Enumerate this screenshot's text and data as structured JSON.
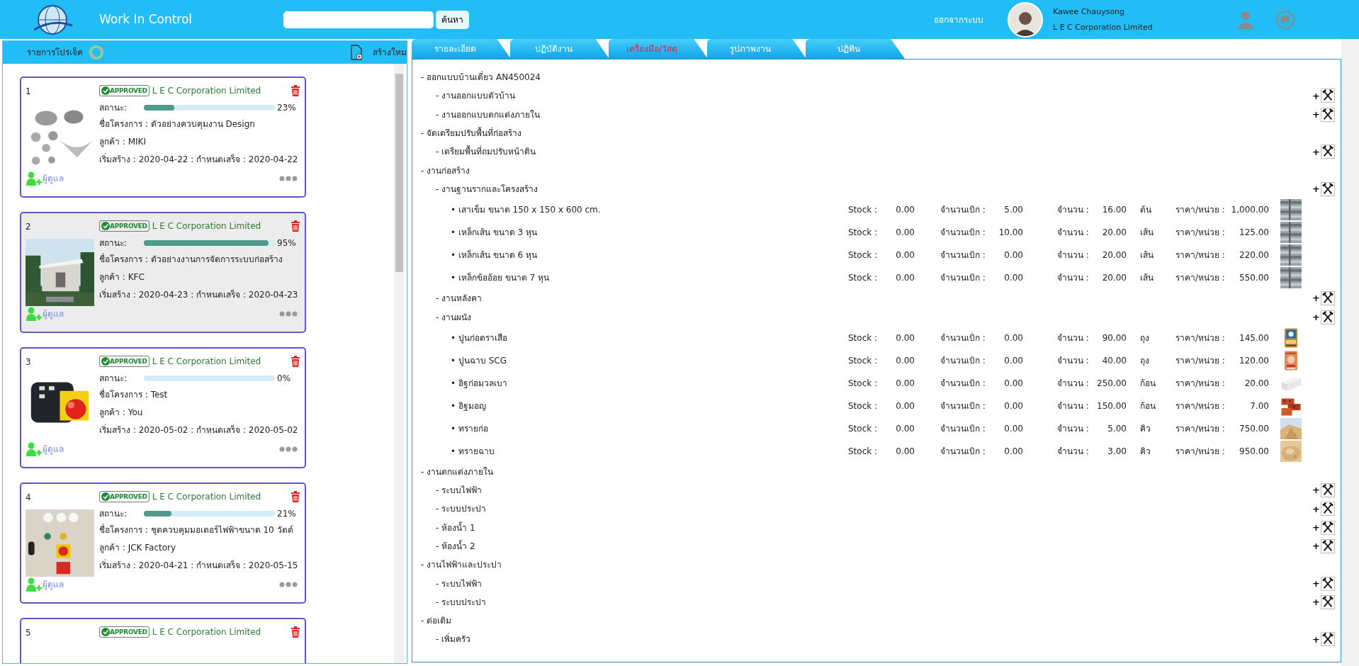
{
  "header": {
    "title": "Work In Control",
    "search": {
      "button": "ค้นหา"
    },
    "logout": "ออกจากระบบ",
    "user": {
      "name": "Kawee Chauysong",
      "company": "L E C Corporation Limited"
    }
  },
  "projects_panel": {
    "title": "รายการโปรเจ็ค",
    "create": "สร้างใหม",
    "projects": [
      {
        "number": "1",
        "badge": "APPROVED",
        "company": "L E C Corporation Limited",
        "selected": false,
        "status_label": "สถานะ:",
        "level": 0.23,
        "percent": "23%",
        "name": "ชื่อโครงการ : ตัวอย่างควบคุมงาน Design",
        "customer": "ลูกค้า : MIKI",
        "dates": "เริ่มสร้าง : 2020-04-22 : กำหนดเสร็จ : 2020-04-22",
        "manager": "ผู้ดูแล"
      },
      {
        "number": "2",
        "badge": "APPROVED",
        "company": "L E C Corporation Limited",
        "selected": true,
        "status_label": "สถานะ:",
        "level": 0.95,
        "percent": "95%",
        "name": "ชื่อโครงการ : ตัวอย่างงานการจัดการระบบก่อสร้าง",
        "customer": "ลูกค้า : KFC",
        "dates": "เริ่มสร้าง : 2020-04-23 : กำหนดเสร็จ : 2020-04-23",
        "manager": "ผู้ดูแล"
      },
      {
        "number": "3",
        "badge": "APPROVED",
        "company": "L E C Corporation Limited",
        "selected": false,
        "status_label": "สถานะ:",
        "level": 0,
        "percent": "0%",
        "name": "ชื่อโครงการ : Test",
        "customer": "ลูกค้า : You",
        "dates": "เริ่มสร้าง : 2020-05-02 : กำหนดเสร็จ : 2020-05-02",
        "manager": "ผู้ดูแล"
      },
      {
        "number": "4",
        "badge": "APPROVED",
        "company": "L E C Corporation Limited",
        "selected": false,
        "status_label": "สถานะ:",
        "level": 0.21,
        "percent": "21%",
        "name": "ชื่อโครงการ : ชุดควบคุมมอเตอร์ไฟฟ้าขนาด 10 วัตต์",
        "customer": "ลูกค้า : JCK Factory",
        "dates": "เริ่มสร้าง : 2020-04-21 : กำหนดเสร็จ : 2020-05-15",
        "manager": "ผู้ดูแล"
      },
      {
        "number": "5",
        "badge": "APPROVED",
        "company": "L E C Corporation Limited",
        "selected": false
      }
    ]
  },
  "tabs": [
    {
      "label": "รายละเอียด",
      "selected": false
    },
    {
      "label": "ปฏิบัติงาน",
      "selected": false
    },
    {
      "label": "เครื่องมือ/วัสดุ",
      "selected": true
    },
    {
      "label": "รูปภาพงาน",
      "selected": false
    },
    {
      "label": "ปฏิทิน",
      "selected": false
    }
  ],
  "tree": [
    {
      "label": "- ออกแบบบ้านเดี่ยว AN450024",
      "children": [
        {
          "label": "- งานออกแบบตัวบ้าน",
          "add": "+"
        },
        {
          "label": "- งานออกแบบตกแต่งภายใน",
          "add": "+"
        }
      ]
    },
    {
      "label": "- จัดเตรียมปรับพื้นที่ก่อสร้าง",
      "children": [
        {
          "label": "- เตรียมพื้นที่ถมปรับหน้าดิน",
          "add": "+"
        }
      ]
    },
    {
      "label": "- งานก่อสร้าง",
      "children": [
        {
          "label": "- งานฐานรากและโครงสร้าง",
          "add": "+",
          "children": [
            {
              "kind": "material",
              "label": "• เสาเข็ม ขนาด 150 x 150 x 600 cm.",
              "stock_label": "Stock :",
              "stock": "0.00",
              "withdrawn_label": "จำนวนเบิก :",
              "withdrawn": "5.00",
              "qty_label": "จำนวน :",
              "qty": "16.00",
              "unit": "ต้น",
              "price_label": "ราคา/หน่วย :",
              "price": "1,000.00"
            },
            {
              "kind": "material",
              "label": "• เหล็กเส้น ขนาด 3 หุน",
              "stock_label": "Stock :",
              "stock": "0.00",
              "withdrawn_label": "จำนวนเบิก :",
              "withdrawn": "10.00",
              "qty_label": "จำนวน :",
              "qty": "20.00",
              "unit": "เส้น",
              "price_label": "ราคา/หน่วย :",
              "price": "125.00"
            },
            {
              "kind": "material",
              "label": "• เหล็กเส้น ขนาด 6 หุน",
              "stock_label": "Stock :",
              "stock": "0.00",
              "withdrawn_label": "จำนวนเบิก :",
              "withdrawn": "0.00",
              "qty_label": "จำนวน :",
              "qty": "20.00",
              "unit": "เส้น",
              "price_label": "ราคา/หน่วย :",
              "price": "220.00"
            },
            {
              "kind": "material",
              "label": "• เหล็กข้ออ้อย ขนาด 7 หุน",
              "stock_label": "Stock :",
              "stock": "0.00",
              "withdrawn_label": "จำนวนเบิก :",
              "withdrawn": "0.00",
              "qty_label": "จำนวน :",
              "qty": "20.00",
              "unit": "เส้น",
              "price_label": "ราคา/หน่วย :",
              "price": "550.00"
            }
          ]
        },
        {
          "label": "- งานหลังคา",
          "add": "+"
        },
        {
          "label": "- งานผนัง",
          "add": "+",
          "children": [
            {
              "kind": "material",
              "label": "• ปูนก่อตราเสือ",
              "stock_label": "Stock :",
              "stock": "0.00",
              "withdrawn_label": "จำนวนเบิก :",
              "withdrawn": "0.00",
              "qty_label": "จำนวน :",
              "qty": "90.00",
              "unit": "ถุง",
              "price_label": "ราคา/หน่วย :",
              "price": "145.00"
            },
            {
              "kind": "material",
              "label": "• ปูนฉาบ SCG",
              "stock_label": "Stock :",
              "stock": "0.00",
              "withdrawn_label": "จำนวนเบิก :",
              "withdrawn": "0.00",
              "qty_label": "จำนวน :",
              "qty": "40.00",
              "unit": "ถุง",
              "price_label": "ราคา/หน่วย :",
              "price": "120.00"
            },
            {
              "kind": "material",
              "label": "• อิฐก่อมวลเบา",
              "stock_label": "Stock :",
              "stock": "0.00",
              "withdrawn_label": "จำนวนเบิก :",
              "withdrawn": "0.00",
              "qty_label": "จำนวน :",
              "qty": "250.00",
              "unit": "ก้อน",
              "price_label": "ราคา/หน่วย :",
              "price": "20.00"
            },
            {
              "kind": "material",
              "label": "• อิฐมอญ",
              "stock_label": "Stock :",
              "stock": "0.00",
              "withdrawn_label": "จำนวนเบิก :",
              "withdrawn": "0.00",
              "qty_label": "จำนวน :",
              "qty": "150.00",
              "unit": "ก้อน",
              "price_label": "ราคา/หน่วย :",
              "price": "7.00"
            },
            {
              "kind": "material",
              "label": "• ทรายก่อ",
              "stock_label": "Stock :",
              "stock": "0.00",
              "withdrawn_label": "จำนวนเบิก :",
              "withdrawn": "0.00",
              "qty_label": "จำนวน :",
              "qty": "5.00",
              "unit": "คิว",
              "price_label": "ราคา/หน่วย :",
              "price": "750.00"
            },
            {
              "kind": "material",
              "label": "• ทรายฉาบ",
              "stock_label": "Stock :",
              "stock": "0.00",
              "withdrawn_label": "จำนวนเบิก :",
              "withdrawn": "0.00",
              "qty_label": "จำนวน :",
              "qty": "3.00",
              "unit": "คิว",
              "price_label": "ราคา/หน่วย :",
              "price": "950.00"
            }
          ]
        }
      ]
    },
    {
      "label": "- งานตกแต่งภายใน",
      "children": [
        {
          "label": "- ระบบไฟฟ้า",
          "add": "+"
        },
        {
          "label": "- ระบบประปา",
          "add": "+"
        },
        {
          "label": "- ห้องน้ำ 1",
          "add": "+"
        },
        {
          "label": "- ห้องน้ำ 2",
          "add": "+"
        }
      ]
    },
    {
      "label": "- งานไฟฟ้าและประปา",
      "children": [
        {
          "label": "- ระบบไฟฟ้า",
          "add": "+"
        },
        {
          "label": "- ระบบประปา",
          "add": "+"
        }
      ]
    },
    {
      "label": "- ต่อเติม",
      "children": [
        {
          "label": "- เพิ่มครัว",
          "add": "+"
        }
      ]
    }
  ]
}
